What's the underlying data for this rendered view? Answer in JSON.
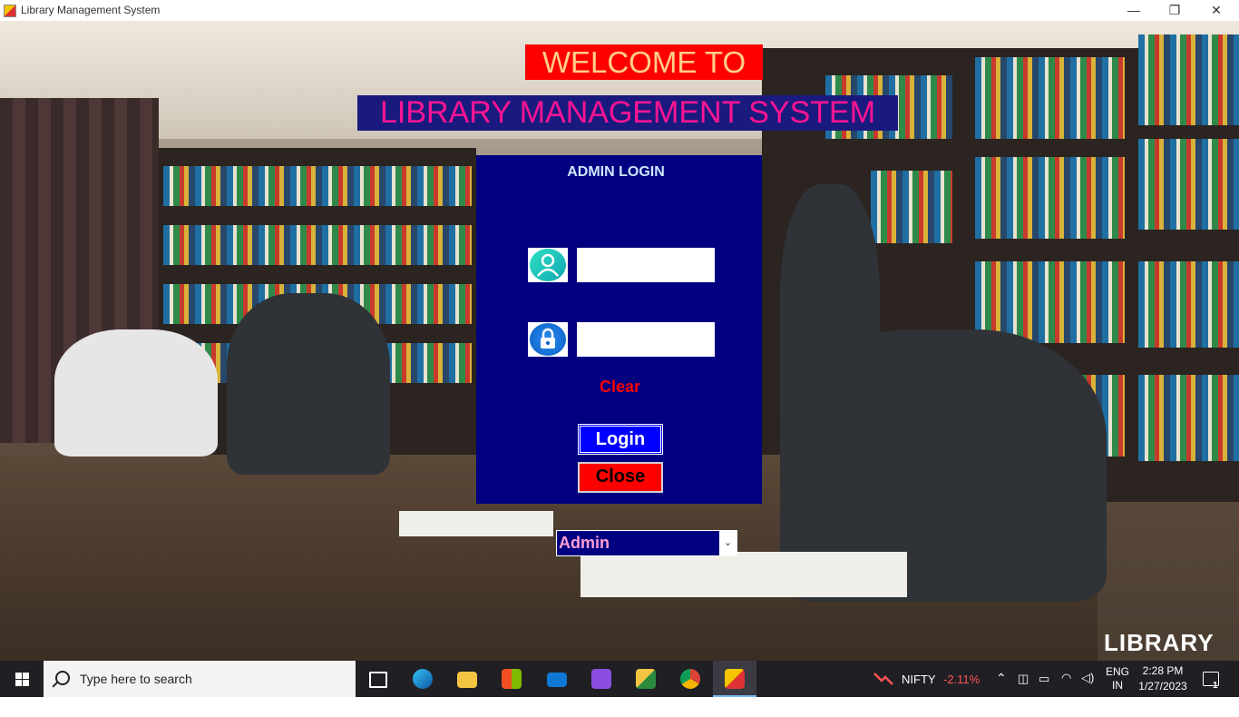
{
  "window": {
    "title": "Library Management System",
    "controls": {
      "minimize": "—",
      "restore": "❐",
      "close": "✕"
    }
  },
  "header": {
    "welcome": "WELCOME TO",
    "system_name": "LIBRARY MANAGEMENT SYSTEM"
  },
  "login_panel": {
    "heading": "ADMIN LOGIN",
    "username": {
      "value": "",
      "icon": "user-icon"
    },
    "password": {
      "value": "",
      "icon": "lock-icon"
    },
    "clear_label": "Clear",
    "login_label": "Login",
    "close_label": "Close"
  },
  "role_select": {
    "selected": "Admin"
  },
  "watermark": "LIBRARY",
  "taskbar": {
    "search_placeholder": "Type here to search",
    "apps": [
      "task-view-icon",
      "edge-icon",
      "file-explorer-icon",
      "store-icon",
      "mail-icon",
      "visual-studio-icon",
      "excel-like-icon",
      "chrome-icon",
      "library-app-icon"
    ],
    "ticker": {
      "name": "NIFTY",
      "change": "-2.11%"
    },
    "language": {
      "line1": "ENG",
      "line2": "IN"
    },
    "clock": {
      "time": "2:28 PM",
      "date": "1/27/2023"
    },
    "notifications": "1"
  },
  "colors": {
    "panel": "#000080",
    "welcome_bg": "#ff0000",
    "welcome_text": "#ffcf87",
    "system_bg": "#1a1a7e",
    "system_text": "#ff1493",
    "login_button": "#0000ff",
    "close_button": "#ff0000",
    "ticker_negative": "#ff5555"
  }
}
